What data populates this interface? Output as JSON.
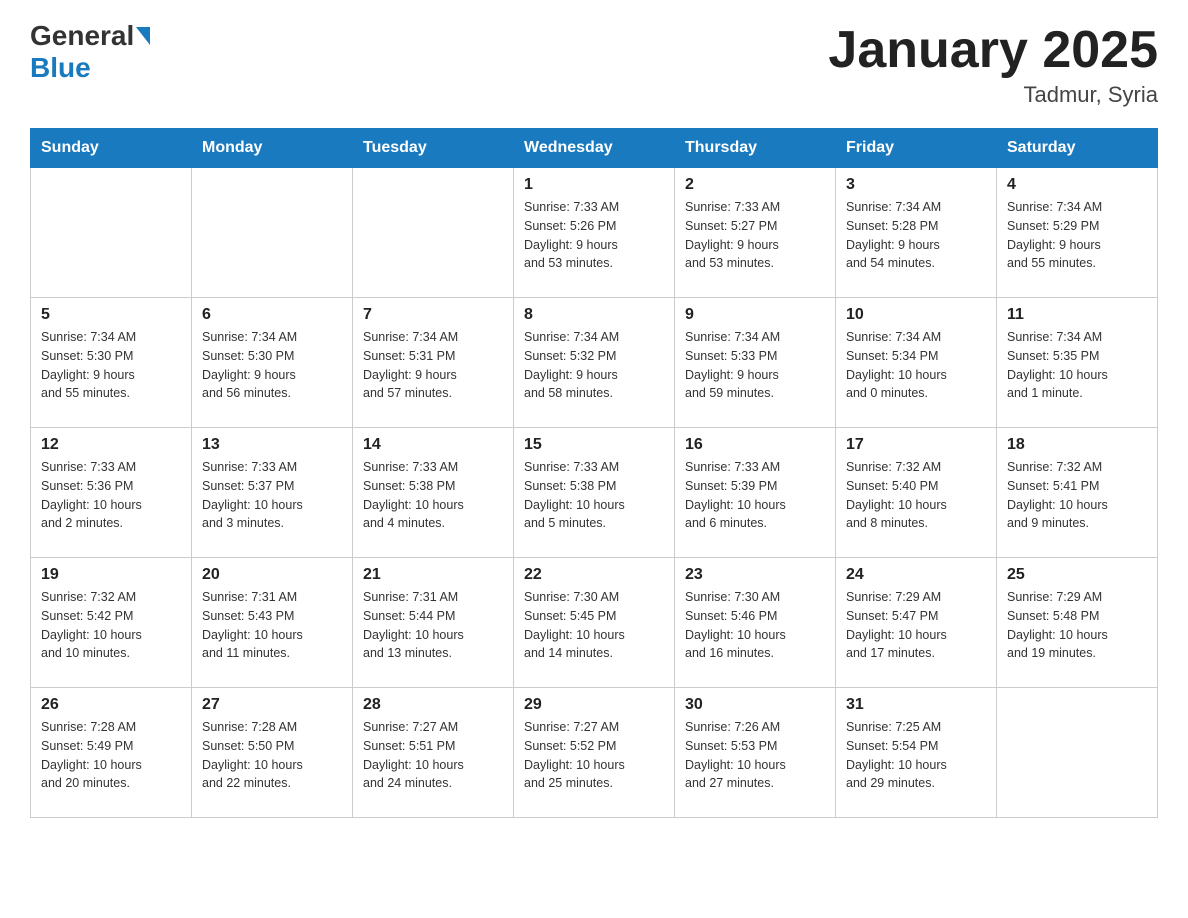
{
  "header": {
    "logo_general": "General",
    "logo_blue": "Blue",
    "month_title": "January 2025",
    "location": "Tadmur, Syria"
  },
  "weekdays": [
    "Sunday",
    "Monday",
    "Tuesday",
    "Wednesday",
    "Thursday",
    "Friday",
    "Saturday"
  ],
  "weeks": [
    [
      {
        "day": "",
        "info": ""
      },
      {
        "day": "",
        "info": ""
      },
      {
        "day": "",
        "info": ""
      },
      {
        "day": "1",
        "info": "Sunrise: 7:33 AM\nSunset: 5:26 PM\nDaylight: 9 hours\nand 53 minutes."
      },
      {
        "day": "2",
        "info": "Sunrise: 7:33 AM\nSunset: 5:27 PM\nDaylight: 9 hours\nand 53 minutes."
      },
      {
        "day": "3",
        "info": "Sunrise: 7:34 AM\nSunset: 5:28 PM\nDaylight: 9 hours\nand 54 minutes."
      },
      {
        "day": "4",
        "info": "Sunrise: 7:34 AM\nSunset: 5:29 PM\nDaylight: 9 hours\nand 55 minutes."
      }
    ],
    [
      {
        "day": "5",
        "info": "Sunrise: 7:34 AM\nSunset: 5:30 PM\nDaylight: 9 hours\nand 55 minutes."
      },
      {
        "day": "6",
        "info": "Sunrise: 7:34 AM\nSunset: 5:30 PM\nDaylight: 9 hours\nand 56 minutes."
      },
      {
        "day": "7",
        "info": "Sunrise: 7:34 AM\nSunset: 5:31 PM\nDaylight: 9 hours\nand 57 minutes."
      },
      {
        "day": "8",
        "info": "Sunrise: 7:34 AM\nSunset: 5:32 PM\nDaylight: 9 hours\nand 58 minutes."
      },
      {
        "day": "9",
        "info": "Sunrise: 7:34 AM\nSunset: 5:33 PM\nDaylight: 9 hours\nand 59 minutes."
      },
      {
        "day": "10",
        "info": "Sunrise: 7:34 AM\nSunset: 5:34 PM\nDaylight: 10 hours\nand 0 minutes."
      },
      {
        "day": "11",
        "info": "Sunrise: 7:34 AM\nSunset: 5:35 PM\nDaylight: 10 hours\nand 1 minute."
      }
    ],
    [
      {
        "day": "12",
        "info": "Sunrise: 7:33 AM\nSunset: 5:36 PM\nDaylight: 10 hours\nand 2 minutes."
      },
      {
        "day": "13",
        "info": "Sunrise: 7:33 AM\nSunset: 5:37 PM\nDaylight: 10 hours\nand 3 minutes."
      },
      {
        "day": "14",
        "info": "Sunrise: 7:33 AM\nSunset: 5:38 PM\nDaylight: 10 hours\nand 4 minutes."
      },
      {
        "day": "15",
        "info": "Sunrise: 7:33 AM\nSunset: 5:38 PM\nDaylight: 10 hours\nand 5 minutes."
      },
      {
        "day": "16",
        "info": "Sunrise: 7:33 AM\nSunset: 5:39 PM\nDaylight: 10 hours\nand 6 minutes."
      },
      {
        "day": "17",
        "info": "Sunrise: 7:32 AM\nSunset: 5:40 PM\nDaylight: 10 hours\nand 8 minutes."
      },
      {
        "day": "18",
        "info": "Sunrise: 7:32 AM\nSunset: 5:41 PM\nDaylight: 10 hours\nand 9 minutes."
      }
    ],
    [
      {
        "day": "19",
        "info": "Sunrise: 7:32 AM\nSunset: 5:42 PM\nDaylight: 10 hours\nand 10 minutes."
      },
      {
        "day": "20",
        "info": "Sunrise: 7:31 AM\nSunset: 5:43 PM\nDaylight: 10 hours\nand 11 minutes."
      },
      {
        "day": "21",
        "info": "Sunrise: 7:31 AM\nSunset: 5:44 PM\nDaylight: 10 hours\nand 13 minutes."
      },
      {
        "day": "22",
        "info": "Sunrise: 7:30 AM\nSunset: 5:45 PM\nDaylight: 10 hours\nand 14 minutes."
      },
      {
        "day": "23",
        "info": "Sunrise: 7:30 AM\nSunset: 5:46 PM\nDaylight: 10 hours\nand 16 minutes."
      },
      {
        "day": "24",
        "info": "Sunrise: 7:29 AM\nSunset: 5:47 PM\nDaylight: 10 hours\nand 17 minutes."
      },
      {
        "day": "25",
        "info": "Sunrise: 7:29 AM\nSunset: 5:48 PM\nDaylight: 10 hours\nand 19 minutes."
      }
    ],
    [
      {
        "day": "26",
        "info": "Sunrise: 7:28 AM\nSunset: 5:49 PM\nDaylight: 10 hours\nand 20 minutes."
      },
      {
        "day": "27",
        "info": "Sunrise: 7:28 AM\nSunset: 5:50 PM\nDaylight: 10 hours\nand 22 minutes."
      },
      {
        "day": "28",
        "info": "Sunrise: 7:27 AM\nSunset: 5:51 PM\nDaylight: 10 hours\nand 24 minutes."
      },
      {
        "day": "29",
        "info": "Sunrise: 7:27 AM\nSunset: 5:52 PM\nDaylight: 10 hours\nand 25 minutes."
      },
      {
        "day": "30",
        "info": "Sunrise: 7:26 AM\nSunset: 5:53 PM\nDaylight: 10 hours\nand 27 minutes."
      },
      {
        "day": "31",
        "info": "Sunrise: 7:25 AM\nSunset: 5:54 PM\nDaylight: 10 hours\nand 29 minutes."
      },
      {
        "day": "",
        "info": ""
      }
    ]
  ]
}
